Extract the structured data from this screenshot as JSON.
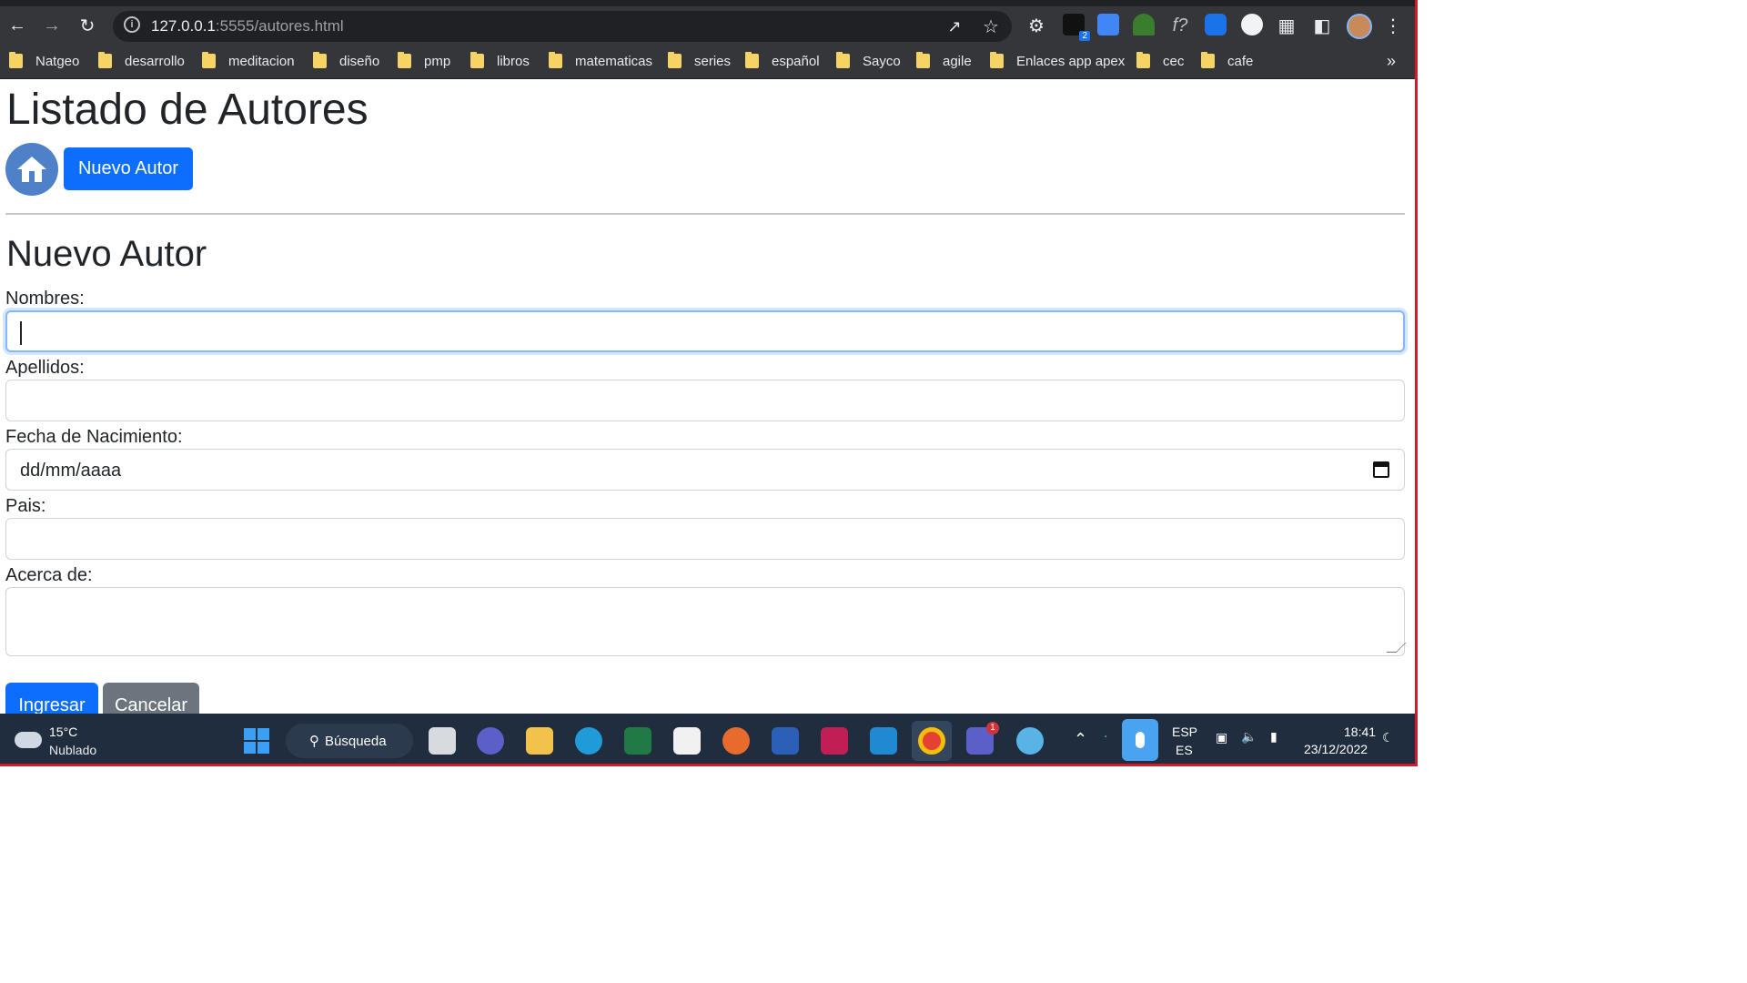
{
  "browser": {
    "url_host": "127.0.0.1",
    "url_path": ":5555/autores.html",
    "bookmarks": [
      "Natgeo",
      "desarrollo",
      "meditacion",
      "diseño",
      "pmp",
      "libros",
      "matematicas",
      "series",
      "español",
      "Sayco",
      "agile",
      "Enlaces app apex",
      "cec",
      "cafe"
    ],
    "more": "»",
    "ext_badge": "2"
  },
  "page": {
    "title": "Listado de Autores",
    "new_button": "Nuevo Autor",
    "form_title": "Nuevo Autor",
    "labels": {
      "nombres": "Nombres:",
      "apellidos": "Apellidos:",
      "fecha": "Fecha de Nacimiento:",
      "pais": "Pais:",
      "acerca": "Acerca de:"
    },
    "values": {
      "nombres": "",
      "apellidos": "",
      "fecha_placeholder": "dd/mm/aaaa",
      "pais": "",
      "acerca": ""
    },
    "buttons": {
      "ingresar": "Ingresar",
      "cancelar": "Cancelar"
    }
  },
  "taskbar": {
    "temp": "15°C",
    "condition": "Nublado",
    "search": "Búsqueda",
    "teams_badge": "1",
    "lang_top": "ESP",
    "lang_bottom": "ES",
    "time": "18:41",
    "date": "23/12/2022"
  }
}
